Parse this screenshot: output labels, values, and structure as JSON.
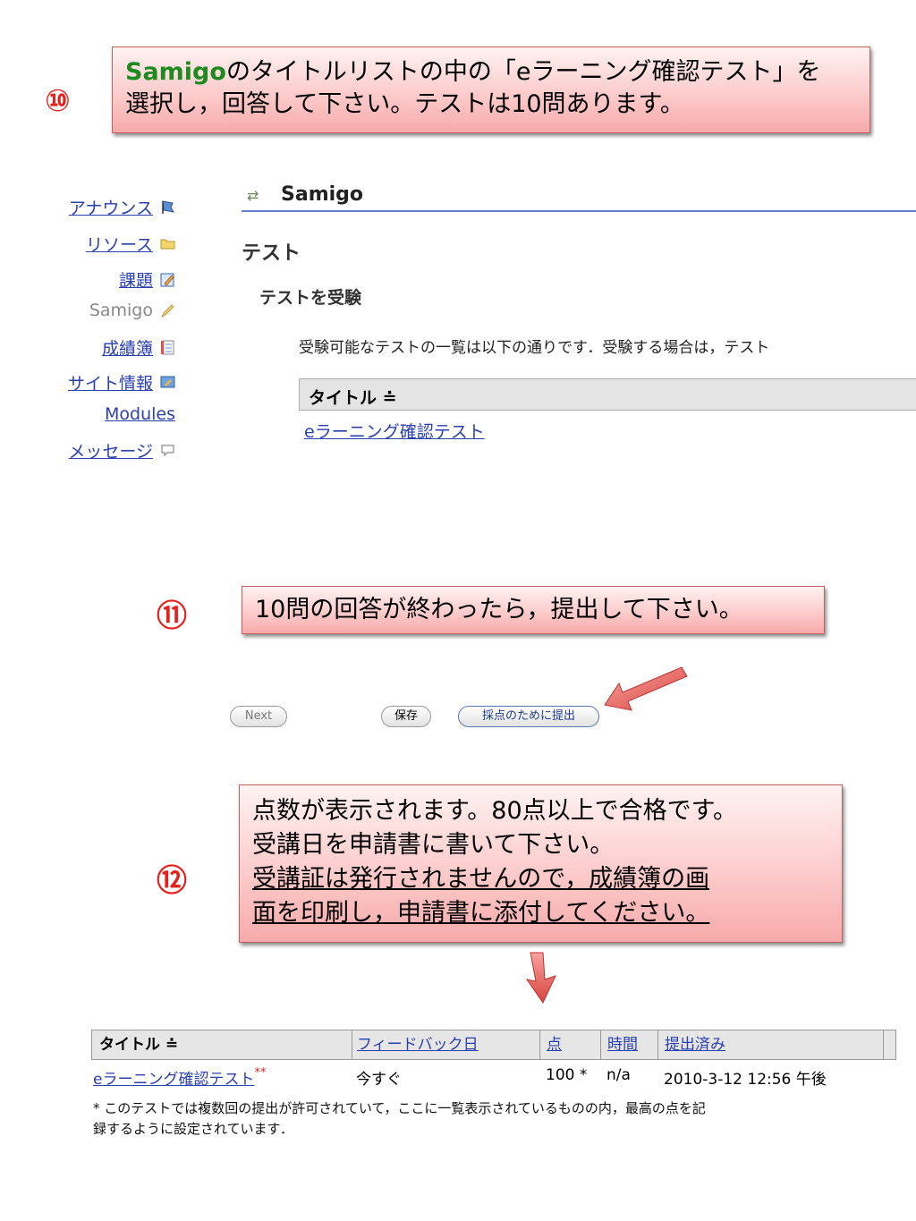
{
  "steps": {
    "s10": "⑩",
    "s11": "⑪",
    "s12": "⑫"
  },
  "callout10": {
    "app": "Samigo",
    "line1_rest": "のタイトルリストの中の「eラーニング確認テスト」を",
    "line2": "選択し，回答して下さい。テストは10問あります。"
  },
  "callout11": {
    "text": "10問の回答が終わったら，提出して下さい。"
  },
  "callout12": {
    "line1": "点数が表示されます。80点以上で合格です。",
    "line2": "受講日を申請書に書いて下さい。",
    "line3": "受講証は発行されませんので，成績簿の画",
    "line4": "面を印刷し，申請書に添付してください。"
  },
  "sidebar": {
    "items": [
      {
        "label": "アナウンス",
        "icon": "flag-icon",
        "link": true
      },
      {
        "label": "リソース",
        "icon": "folder-icon",
        "link": true
      },
      {
        "label": "課題",
        "icon": "pencil-paper-icon",
        "link": true
      },
      {
        "label": "Samigo",
        "icon": "pencil-icon",
        "link": false
      },
      {
        "label": "成績簿",
        "icon": "gradebook-icon",
        "link": true
      },
      {
        "label": "サイト情報",
        "icon": "site-info-icon",
        "link": true
      },
      {
        "label": "Modules",
        "icon": "",
        "link": true
      },
      {
        "label": "メッセージ",
        "icon": "speech-bubble-icon",
        "link": true
      }
    ]
  },
  "samigo": {
    "tool_name": "Samigo",
    "heading": "テスト",
    "subheading": "テストを受験",
    "description": "受験可能なテストの一覧は以下の通りです．受験する場合は，テスト",
    "column_title": "タイトル ≐",
    "test_link": "eラーニング確認テスト"
  },
  "buttons": {
    "next": "Next",
    "save": "保存",
    "submit": "採点のために提出"
  },
  "results": {
    "headers": [
      "タイトル ≐",
      "フィードバック日",
      "点",
      "時間",
      "提出済み"
    ],
    "row": {
      "title": "eラーニング確認テスト",
      "title_mark": "**",
      "feedback": "今すぐ",
      "score": "100 *",
      "time": "n/a",
      "submitted": "2010-3-12 12:56 午後"
    },
    "note_line1": "* このテストでは複数回の提出が許可されていて，ここに一覧表示されているものの内，最高の点を記",
    "note_line2": "録するように設定されています．"
  },
  "colors": {
    "step_red": "#e8201c",
    "link_blue": "#2a3fb0",
    "app_green": "#1f8a1f",
    "arrow_red": "#e35a55"
  }
}
